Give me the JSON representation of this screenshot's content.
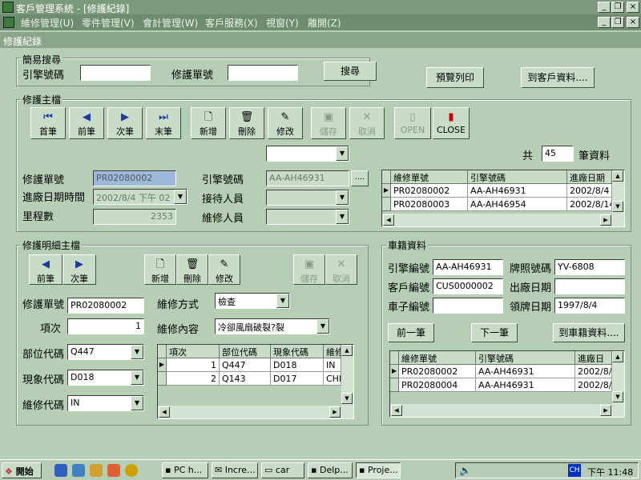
{
  "window": {
    "title": "客戶管理系統 - [修護紀錄]",
    "min": "_",
    "max": "❐",
    "close": "×"
  },
  "menu": [
    "維修管理(U)",
    "零件管理(V)",
    "會計管理(W)",
    "客戶服務(X)",
    "視窗(Y)",
    "離開(Z)"
  ],
  "form_title": "修護紀錄",
  "search": {
    "group": "簡易搜尋",
    "engine_label": "引擎號碼",
    "order_label": "修護單號",
    "engine_value": "",
    "order_value": "",
    "search_btn": "搜尋"
  },
  "top_buttons": {
    "preview": "預覽列印",
    "goto_customer": "到客戶資料...."
  },
  "main": {
    "group": "修護主檔",
    "nav": {
      "first": "首筆",
      "prev": "前筆",
      "next": "次筆",
      "last": "末筆",
      "new": "新增",
      "delete": "刪除",
      "edit": "修改",
      "save": "儲存",
      "cancel": "取消",
      "open": "OPEN",
      "close": "CLOSE"
    },
    "count_prefix": "共",
    "count_value": "45",
    "count_suffix": "筆資料",
    "order_label": "修護單號",
    "order_value": "PR02080002",
    "entry_label": "進廠日期時間",
    "entry_value": "2002/8/4 下午 02",
    "mileage_label": "里程數",
    "mileage_value": "2353",
    "engine_label": "引擎號碼",
    "engine_value": "AA-AH46931",
    "engine_btn": "....",
    "reception_label": "接待人員",
    "reception_value": "",
    "repairer_label": "維修人員",
    "repairer_value": "",
    "top_combo_value": "",
    "grid": {
      "headers": [
        "維修單號",
        "引擎號碼",
        "進廠日期"
      ],
      "rows": [
        [
          "PR02080002",
          "AA-AH46931",
          "2002/8/4"
        ],
        [
          "PR02080003",
          "AA-AH46954",
          "2002/8/14"
        ]
      ]
    }
  },
  "detail": {
    "group": "修護明細主檔",
    "nav": {
      "prev": "前筆",
      "next": "次筆",
      "new": "新增",
      "delete": "刪除",
      "edit": "修改",
      "save": "儲存",
      "cancel": "取消"
    },
    "order_label": "修護單號",
    "order_value": "PR02080002",
    "item_label": "項次",
    "item_value": "1",
    "part_label": "部位代碼",
    "part_value": "Q447",
    "symptom_label": "現象代碼",
    "symptom_value": "D018",
    "repair_label": "維修代碼",
    "repair_value": "IN",
    "method_label": "維修方式",
    "method_value": "檢查",
    "content_label": "維修內容",
    "content_value": "冷卻風扇破裂?裂",
    "grid": {
      "headers": [
        "項次",
        "部位代碼",
        "現象代碼",
        "維修"
      ],
      "rows": [
        [
          "1",
          "Q447",
          "D018",
          "IN"
        ],
        [
          "2",
          "Q143",
          "D017",
          "CHF"
        ]
      ]
    }
  },
  "vehicle": {
    "group": "車籍資料",
    "engine_label": "引擎編號",
    "engine_value": "AA-AH46931",
    "plate_label": "牌照號碼",
    "plate_value": "YV-6808",
    "customer_label": "客戶編號",
    "customer_value": "CUS0000002",
    "factory_label": "出廠日期",
    "factory_value": "",
    "chassis_label": "車子編號",
    "chassis_value": "",
    "license_label": "領牌日期",
    "license_value": "1997/8/4",
    "prev_btn": "前一筆",
    "next_btn": "下一筆",
    "goto_btn": "到車籍資料....",
    "grid": {
      "headers": [
        "維修單號",
        "引擎號碼",
        "進廠日"
      ],
      "rows": [
        [
          "PR02080002",
          "AA-AH46931",
          "2002/8/"
        ],
        [
          "PR02080004",
          "AA-AH46931",
          "2002/8/"
        ]
      ]
    }
  },
  "taskbar": {
    "start": "開始",
    "tasks": [
      "PC h...",
      "Incre...",
      "car",
      "Delp...",
      "Proje..."
    ],
    "clock": "下午 11:48",
    "ime": "CH"
  },
  "colors": {
    "bg": "#b5ceb5",
    "title": "#7b9a7b",
    "selected_field": "#9db9d9",
    "grid_select": "#000080"
  }
}
